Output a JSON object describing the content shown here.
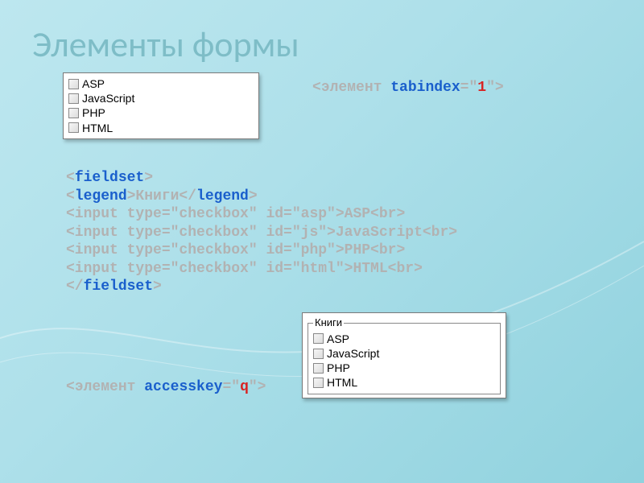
{
  "title": "Элементы формы",
  "checkbox_items": [
    "ASP",
    "JavaScript",
    "PHP",
    "HTML"
  ],
  "fieldset_legend": "Книги",
  "tabindex_line": {
    "open": "<",
    "element": "элемент ",
    "attr": "tabindex",
    "eq": "=\"",
    "val": "1",
    "close": "\">"
  },
  "accesskey_line": {
    "open": "<",
    "element": "элемент ",
    "attr": "accesskey",
    "eq": "=\"",
    "val": "q",
    "close": "\">"
  },
  "code": {
    "l1a": "<",
    "l1b": "fieldset",
    "l1c": ">",
    "l2a": "<",
    "l2b": "legend",
    "l2c": ">Книги</",
    "l2d": "legend",
    "l2e": ">",
    "l3": "<input type=\"checkbox\" id=\"asp\">ASP<br>",
    "l4": "<input type=\"checkbox\" id=\"js\">JavaScript<br>",
    "l5": "<input type=\"checkbox\" id=\"php\">PHP<br>",
    "l6": "<input type=\"checkbox\" id=\"html\">HTML<br>",
    "l7a": "</",
    "l7b": "fieldset",
    "l7c": ">"
  }
}
